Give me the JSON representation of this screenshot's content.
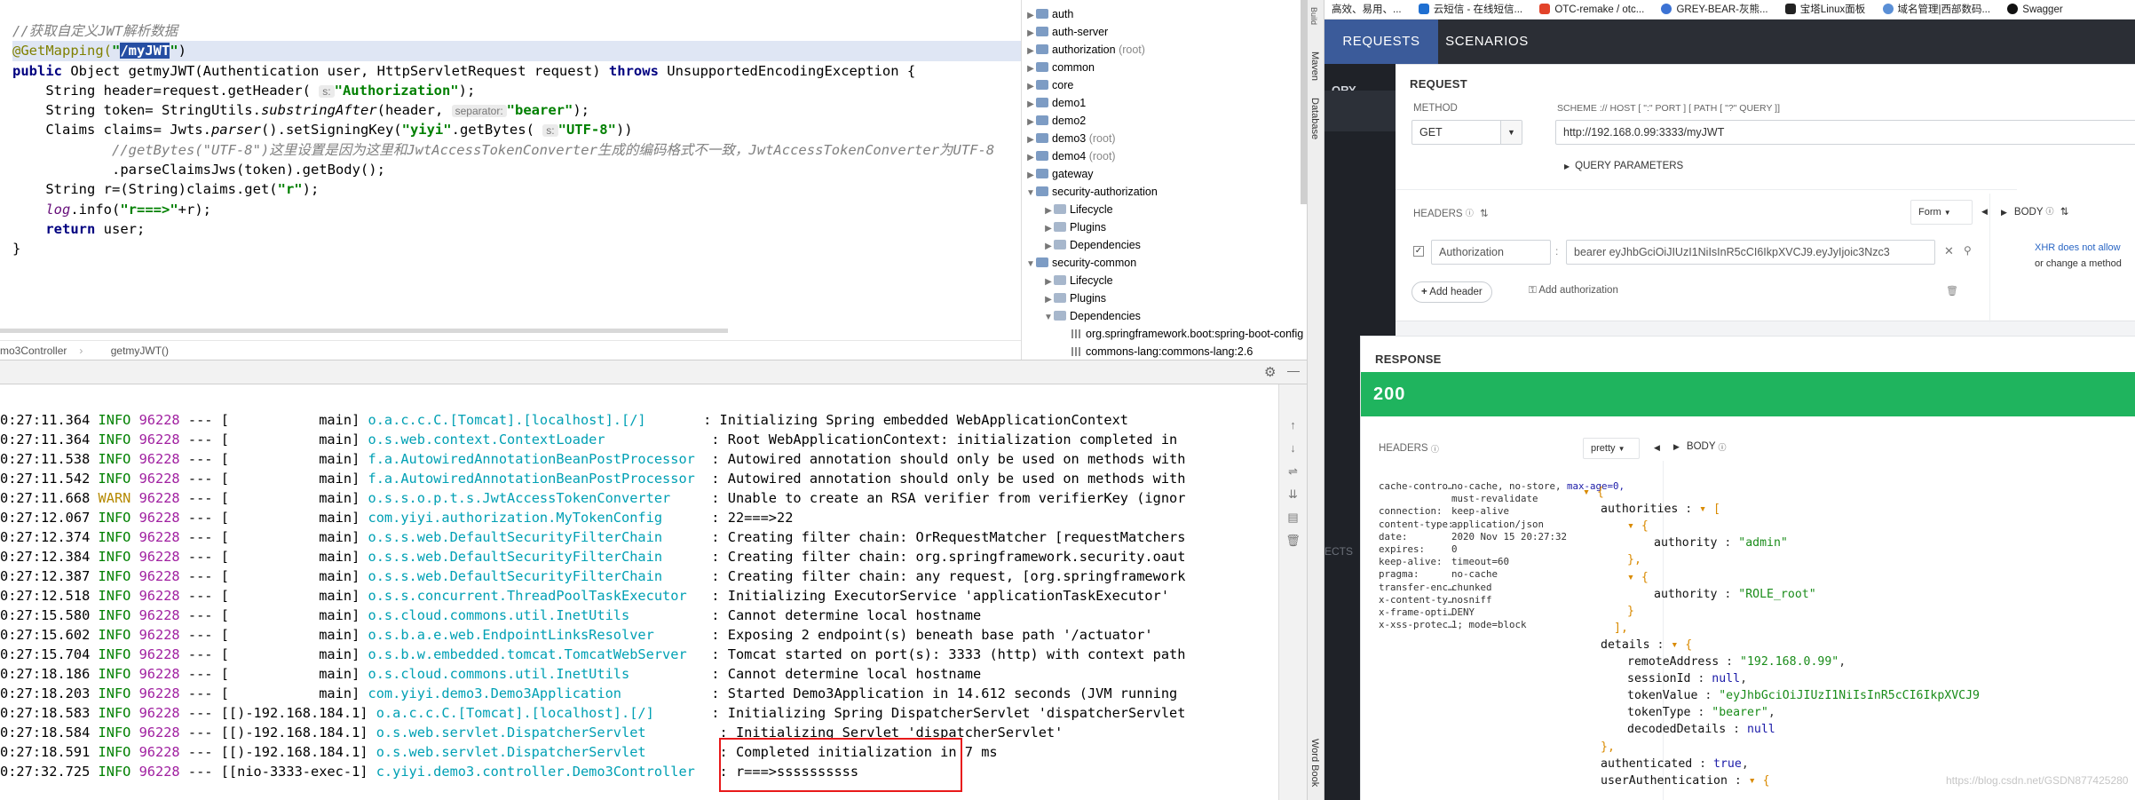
{
  "editor": {
    "lines": {
      "l1": "//获取自定义JWT解析数据",
      "l2_ann": "@GetMapping(",
      "l2_q1": "\"",
      "l2_path": "/myJWT",
      "l2_q2": "\"",
      "l2_end": ")",
      "l3_public": "public",
      "l3_a": " Object getmyJWT(Authentication user, HttpServletRequest request) ",
      "l3_throws": "throws",
      "l3_b": " UnsupportedEncodingException {",
      "l4_a": "    String header=request.getHeader( ",
      "l4_hint": "s:",
      "l4_str": "\"Authorization\"",
      "l4_b": ");",
      "l5_a": "    String token= StringUtils.",
      "l5_m": "substringAfter",
      "l5_b": "(header, ",
      "l5_hint": "separator:",
      "l5_str": "\"bearer\"",
      "l5_c": ");",
      "l6_a": "    Claims claims= Jwts.",
      "l6_m": "parser",
      "l6_b": "().setSigningKey(",
      "l6_str": "\"yiyi\"",
      "l6_c": ".getBytes( ",
      "l6_hint": "s:",
      "l6_str2": "\"UTF-8\"",
      "l6_d": "))",
      "l7": "            //getBytes(\"UTF-8\")这里设置是因为这里和JwtAccessTokenConverter生成的编码格式不一致，JwtAccessTokenConverter为UTF-8",
      "l8": "            .parseClaimsJws(token).getBody();",
      "l9_a": "    String r=(String)claims.get(",
      "l9_str": "\"r\"",
      "l9_b": ");",
      "l10_log": "    log",
      "l10_a": ".info(",
      "l10_str": "\"r===>\"",
      "l10_b": "+r);",
      "l11_kw": "    return",
      "l11_a": " user;",
      "l12": "}"
    },
    "breadcrumb": [
      "mo3Controller",
      "getmyJWT()"
    ]
  },
  "tree": {
    "items": [
      {
        "label": "auth",
        "suffix": ""
      },
      {
        "label": "auth-server",
        "suffix": ""
      },
      {
        "label": "authorization",
        "suffix": "(root)"
      },
      {
        "label": "common",
        "suffix": ""
      },
      {
        "label": "core",
        "suffix": ""
      },
      {
        "label": "demo1",
        "suffix": ""
      },
      {
        "label": "demo2",
        "suffix": ""
      },
      {
        "label": "demo3",
        "suffix": "(root)"
      },
      {
        "label": "demo4",
        "suffix": "(root)"
      },
      {
        "label": "gateway",
        "suffix": ""
      },
      {
        "label": "security-authorization",
        "suffix": ""
      },
      {
        "label": "Lifecycle",
        "suffix": ""
      },
      {
        "label": "Plugins",
        "suffix": ""
      },
      {
        "label": "Dependencies",
        "suffix": ""
      },
      {
        "label": "security-common",
        "suffix": ""
      },
      {
        "label": "Lifecycle",
        "suffix": ""
      },
      {
        "label": "Plugins",
        "suffix": ""
      },
      {
        "label": "Dependencies",
        "suffix": ""
      },
      {
        "label": "org.springframework.boot:spring-boot-config",
        "suffix": ""
      },
      {
        "label": "commons-lang:commons-lang:2.6",
        "suffix": ""
      }
    ]
  },
  "side_tabs": [
    "Maven",
    "Database",
    "Word Book"
  ],
  "console": {
    "rows": [
      {
        "time": "0:27:11.364",
        "level": "INFO",
        "pid": "96228",
        "thread": "           main",
        "logger": "o.a.c.c.C.[Tomcat].[localhost].[/]      ",
        "msg": "Initializing Spring embedded WebApplicationContext"
      },
      {
        "time": "0:27:11.364",
        "level": "INFO",
        "pid": "96228",
        "thread": "           main",
        "logger": "o.s.web.context.ContextLoader            ",
        "msg": "Root WebApplicationContext: initialization completed in"
      },
      {
        "time": "0:27:11.538",
        "level": "INFO",
        "pid": "96228",
        "thread": "           main",
        "logger": "f.a.AutowiredAnnotationBeanPostProcessor ",
        "msg": "Autowired annotation should only be used on methods with"
      },
      {
        "time": "0:27:11.542",
        "level": "INFO",
        "pid": "96228",
        "thread": "           main",
        "logger": "f.a.AutowiredAnnotationBeanPostProcessor ",
        "msg": "Autowired annotation should only be used on methods with"
      },
      {
        "time": "0:27:11.668",
        "level": "WARN",
        "pid": "96228",
        "thread": "           main",
        "logger": "o.s.s.o.p.t.s.JwtAccessTokenConverter    ",
        "msg": "Unable to create an RSA verifier from verifierKey (ignor"
      },
      {
        "time": "0:27:12.067",
        "level": "INFO",
        "pid": "96228",
        "thread": "           main",
        "logger": "com.yiyi.authorization.MyTokenConfig     ",
        "msg": "22===>22"
      },
      {
        "time": "0:27:12.374",
        "level": "INFO",
        "pid": "96228",
        "thread": "           main",
        "logger": "o.s.s.web.DefaultSecurityFilterChain     ",
        "msg": "Creating filter chain: OrRequestMatcher [requestMatchers"
      },
      {
        "time": "0:27:12.384",
        "level": "INFO",
        "pid": "96228",
        "thread": "           main",
        "logger": "o.s.s.web.DefaultSecurityFilterChain     ",
        "msg": "Creating filter chain: org.springframework.security.oaut"
      },
      {
        "time": "0:27:12.387",
        "level": "INFO",
        "pid": "96228",
        "thread": "           main",
        "logger": "o.s.s.web.DefaultSecurityFilterChain     ",
        "msg": "Creating filter chain: any request, [org.springframework"
      },
      {
        "time": "0:27:12.518",
        "level": "INFO",
        "pid": "96228",
        "thread": "           main",
        "logger": "o.s.s.concurrent.ThreadPoolTaskExecutor  ",
        "msg": "Initializing ExecutorService 'applicationTaskExecutor'"
      },
      {
        "time": "0:27:15.580",
        "level": "INFO",
        "pid": "96228",
        "thread": "           main",
        "logger": "o.s.cloud.commons.util.InetUtils         ",
        "msg": "Cannot determine local hostname"
      },
      {
        "time": "0:27:15.602",
        "level": "INFO",
        "pid": "96228",
        "thread": "           main",
        "logger": "o.s.b.a.e.web.EndpointLinksResolver      ",
        "msg": "Exposing 2 endpoint(s) beneath base path '/actuator'"
      },
      {
        "time": "0:27:15.704",
        "level": "INFO",
        "pid": "96228",
        "thread": "           main",
        "logger": "o.s.b.w.embedded.tomcat.TomcatWebServer  ",
        "msg": "Tomcat started on port(s): 3333 (http) with context path"
      },
      {
        "time": "0:27:18.186",
        "level": "INFO",
        "pid": "96228",
        "thread": "           main",
        "logger": "o.s.cloud.commons.util.InetUtils         ",
        "msg": "Cannot determine local hostname"
      },
      {
        "time": "0:27:18.203",
        "level": "INFO",
        "pid": "96228",
        "thread": "           main",
        "logger": "com.yiyi.demo3.Demo3Application          ",
        "msg": "Started Demo3Application in 14.612 seconds (JVM running"
      },
      {
        "time": "0:27:18.583",
        "level": "INFO",
        "pid": "96228",
        "thread": "[)-192.168.184.1",
        "logger": "o.a.c.c.C.[Tomcat].[localhost].[/]      ",
        "msg": "Initializing Spring DispatcherServlet 'dispatcherServlet"
      },
      {
        "time": "0:27:18.584",
        "level": "INFO",
        "pid": "96228",
        "thread": "[)-192.168.184.1",
        "logger": "o.s.web.servlet.DispatcherServlet        ",
        "msg": "Initializing Servlet 'dispatcherServlet'"
      },
      {
        "time": "0:27:18.591",
        "level": "INFO",
        "pid": "96228",
        "thread": "[)-192.168.184.1",
        "logger": "o.s.web.servlet.DispatcherServlet        ",
        "msg": "Completed initialization in 7 ms"
      },
      {
        "time": "0:27:32.725",
        "level": "INFO",
        "pid": "96228",
        "thread": "[nio-3333-exec-1",
        "logger": "c.yiyi.demo3.controller.Demo3Controller  ",
        "msg": "r===>ssssssssss"
      }
    ]
  },
  "browser": {
    "bookmarks": [
      "高效、易用、...",
      "云短信 - 在线短信...",
      "OTC-remake / otc...",
      "GREY-BEAR-灰熊...",
      "宝塔Linux面板",
      "域名管理|西部数码...",
      "Swagger"
    ],
    "tabs": [
      "REQUESTS",
      "SCENARIOS"
    ],
    "history_label": "ORY",
    "side_label": "ECTS",
    "request": {
      "title": "REQUEST",
      "method_label": "METHOD",
      "method": "GET",
      "scheme_label": "SCHEME :// HOST [ \":\" PORT ] [ PATH [ \"?\" QUERY ]]",
      "url": "http://192.168.0.99:3333/myJWT",
      "query_params": "QUERY PARAMETERS",
      "headers_label": "HEADERS",
      "form_label": "Form",
      "body_label": "BODY",
      "header_name": "Authorization",
      "header_value": "bearer eyJhbGciOiJIUzI1NiIsInR5cCI6IkpXVCJ9.eyJyIjoic3Nzc3",
      "add_header": "Add header",
      "add_auth": "Add authorization",
      "xhr_note_1": "XHR does not allow",
      "xhr_note_2": "or change a method"
    },
    "response": {
      "title": "RESPONSE",
      "status": "200",
      "headers_label": "HEADERS",
      "pretty_label": "pretty",
      "body_label": "BODY",
      "headers": [
        {
          "k": "cache-contro…",
          "v": "no-cache, no-store, ",
          "v2": "max-age=0,"
        },
        {
          "k": "",
          "v": "must-revalidate",
          "v2": ""
        },
        {
          "k": "connection:",
          "v": "keep-alive",
          "v2": ""
        },
        {
          "k": "content-type:",
          "v": "application/json",
          "v2": ""
        },
        {
          "k": "date:",
          "v": "2020 Nov 15 20:27:32",
          "v2": ""
        },
        {
          "k": "expires:",
          "v": "0",
          "v2": ""
        },
        {
          "k": "keep-alive:",
          "v": "timeout=60",
          "v2": ""
        },
        {
          "k": "pragma:",
          "v": "no-cache",
          "v2": ""
        },
        {
          "k": "transfer-enc…",
          "v": "chunked",
          "v2": ""
        },
        {
          "k": "x-content-ty…",
          "v": "nosniff",
          "v2": ""
        },
        {
          "k": "x-frame-opti…",
          "v": "DENY",
          "v2": ""
        },
        {
          "k": "x-xss-protec…",
          "v": "1; mode=block",
          "v2": ""
        }
      ],
      "json": {
        "authorities_key": "authorities",
        "authority_key": "authority",
        "authority_1": "\"admin\"",
        "authority_2": "\"ROLE_root\"",
        "details_key": "details",
        "remoteAddress_key": "remoteAddress",
        "remoteAddress": "\"192.168.0.99\"",
        "sessionId_key": "sessionId",
        "sessionId": "null",
        "tokenValue_key": "tokenValue",
        "tokenValue": "\"eyJhbGciOiJIUzI1NiIsInR5cCI6IkpXVCJ9",
        "tokenType_key": "tokenType",
        "tokenType": "\"bearer\"",
        "decodedDetails_key": "decodedDetails",
        "decodedDetails": "null",
        "authenticated_key": "authenticated",
        "authenticated": "true",
        "userAuthentication_key": "userAuthentication"
      }
    },
    "watermark": "https://blog.csdn.net/GSDN877425280"
  }
}
